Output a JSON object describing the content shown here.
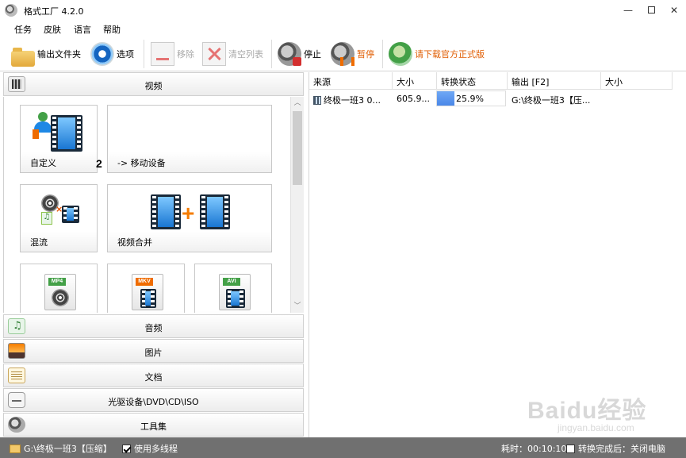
{
  "window": {
    "title": "格式工厂 4.2.0",
    "controls": {
      "minimize": "—",
      "close": "✕"
    }
  },
  "menu": [
    "任务",
    "皮肤",
    "语言",
    "帮助"
  ],
  "toolbar": {
    "output_folder": "输出文件夹",
    "options": "选项",
    "remove": "移除",
    "clear_list": "清空列表",
    "stop": "停止",
    "pause": "暂停",
    "download": "请下载官方正式版"
  },
  "left": {
    "categories": {
      "video": "视频",
      "audio": "音频",
      "image": "图片",
      "document": "文档",
      "disc": "光驱设备\\DVD\\CD\\ISO",
      "tools": "工具集"
    },
    "tiles": {
      "custom": {
        "label": "自定义",
        "count": "2"
      },
      "mobile": {
        "label": "-> 移动设备"
      },
      "mux": {
        "label": "混流"
      },
      "join": {
        "label": "视频合并"
      },
      "mp4": {
        "tag": "MP4"
      },
      "mkv": {
        "tag": "MKV"
      },
      "avi": {
        "tag": "AVI"
      }
    }
  },
  "task_list": {
    "columns": [
      "来源",
      "大小",
      "转换状态",
      "输出 [F2]",
      "大小"
    ],
    "rows": [
      {
        "source": "终极一班3 0...",
        "size": "605.9...",
        "status": "25.9%",
        "progress": 0.259,
        "output": "G:\\终极一班3【压...",
        "out_size": ""
      }
    ]
  },
  "statusbar": {
    "output_path": "G:\\终极一班3【压缩】",
    "multithread_label": "使用多线程",
    "multithread_checked": true,
    "elapsed": "耗时：00:10:10",
    "after_label": "转换完成后：关闭电脑",
    "after_checked": false
  },
  "watermark": {
    "main": "Baidu经验",
    "sub": "jingyan.baidu.com"
  }
}
